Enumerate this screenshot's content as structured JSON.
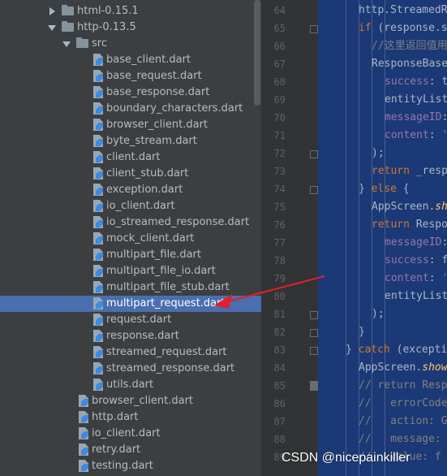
{
  "project_tree": {
    "rows": [
      {
        "label": "html-0.15.1",
        "kind": "folder-collapsed"
      },
      {
        "label": "http-0.13.5",
        "kind": "folder-expanded"
      },
      {
        "label": "src",
        "kind": "folder-expanded-src"
      },
      {
        "label": "base_client.dart",
        "kind": "dart-file"
      },
      {
        "label": "base_request.dart",
        "kind": "dart-file"
      },
      {
        "label": "base_response.dart",
        "kind": "dart-file"
      },
      {
        "label": "boundary_characters.dart",
        "kind": "dart-file"
      },
      {
        "label": "browser_client.dart",
        "kind": "dart-file"
      },
      {
        "label": "byte_stream.dart",
        "kind": "dart-file"
      },
      {
        "label": "client.dart",
        "kind": "dart-file"
      },
      {
        "label": "client_stub.dart",
        "kind": "dart-file"
      },
      {
        "label": "exception.dart",
        "kind": "dart-file"
      },
      {
        "label": "io_client.dart",
        "kind": "dart-file"
      },
      {
        "label": "io_streamed_response.dart",
        "kind": "dart-file"
      },
      {
        "label": "mock_client.dart",
        "kind": "dart-file"
      },
      {
        "label": "multipart_file.dart",
        "kind": "dart-file"
      },
      {
        "label": "multipart_file_io.dart",
        "kind": "dart-file"
      },
      {
        "label": "multipart_file_stub.dart",
        "kind": "dart-file"
      },
      {
        "label": "multipart_request.dart",
        "kind": "dart-file",
        "selected": true
      },
      {
        "label": "request.dart",
        "kind": "dart-file"
      },
      {
        "label": "response.dart",
        "kind": "dart-file"
      },
      {
        "label": "streamed_request.dart",
        "kind": "dart-file"
      },
      {
        "label": "streamed_response.dart",
        "kind": "dart-file"
      },
      {
        "label": "utils.dart",
        "kind": "dart-file"
      },
      {
        "label": "browser_client.dart",
        "kind": "dart-file-outer"
      },
      {
        "label": "http.dart",
        "kind": "dart-file-outer"
      },
      {
        "label": "io_client.dart",
        "kind": "dart-file-outer"
      },
      {
        "label": "retry.dart",
        "kind": "dart-file-outer"
      },
      {
        "label": "testing.dart",
        "kind": "dart-file-outer"
      }
    ]
  },
  "editor": {
    "line_numbers": [
      "64",
      "65",
      "66",
      "67",
      "68",
      "69",
      "70",
      "71",
      "72",
      "73",
      "74",
      "75",
      "76",
      "77",
      "78",
      "79",
      "80",
      "81",
      "82",
      "83",
      "84",
      "85",
      "86",
      "87",
      "88",
      "89"
    ],
    "lines": [
      "http.StreamedR",
      "if (response.s",
      "//这里返回值用",
      "ResponseBase",
      "success: t",
      "entityList",
      "messageID:",
      "content: '",
      ");",
      "return _resp",
      "} else {",
      "AppScreen.sh",
      "return Respo",
      "messageID:",
      "success: f",
      "content: '",
      "entityList",
      ");",
      "}",
      "} catch (excepti",
      "AppScreen.show",
      "// return Resp",
      "//   errorCode",
      "//   action: G",
      "//   message:",
      "//   value: f"
    ]
  },
  "colors": {
    "tree_bg": "#3c3f41",
    "selection": "#4b6eaf",
    "annotation_arrow": "#e0202a"
  },
  "watermark": "CSDN @nicepainkiller"
}
